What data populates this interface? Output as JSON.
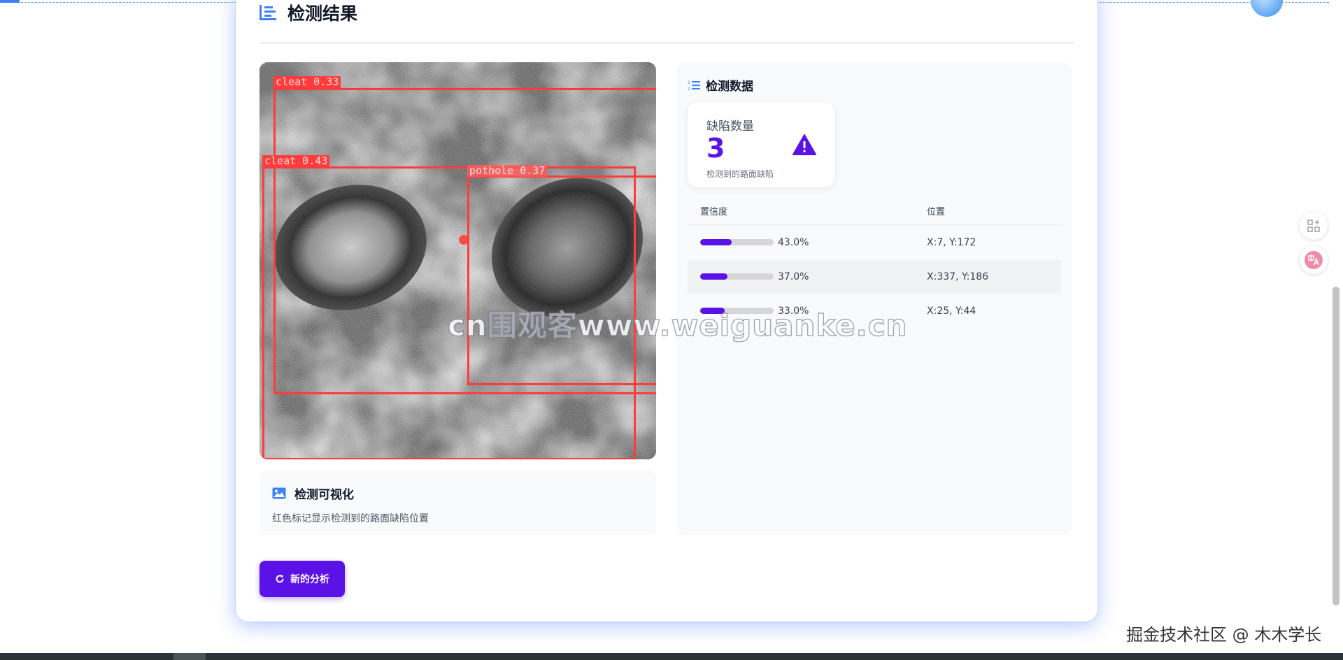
{
  "section": {
    "title": "检测结果"
  },
  "image": {
    "detections": [
      {
        "label": "cleat 0.33"
      },
      {
        "label": "cleat 0.43"
      },
      {
        "label": "pothole 0.37"
      }
    ]
  },
  "visualization": {
    "title": "检测可视化",
    "description": "红色标记显示检测到的路面缺陷位置"
  },
  "data_panel": {
    "title": "检测数据",
    "stat": {
      "label": "缺陷数量",
      "value": "3",
      "subtitle": "检测到的路面缺陷"
    },
    "table": {
      "headers": {
        "confidence": "置信度",
        "position": "位置"
      },
      "rows": [
        {
          "confidence": 0.43,
          "confidence_text": "43.0%",
          "position": "X:7, Y:172"
        },
        {
          "confidence": 0.37,
          "confidence_text": "37.0%",
          "position": "X:337, Y:186"
        },
        {
          "confidence": 0.33,
          "confidence_text": "33.0%",
          "position": "X:25, Y:44"
        }
      ]
    }
  },
  "actions": {
    "new_analysis": "新的分析"
  },
  "watermark": "cn围观客www.weiguanke.cn",
  "footer": "掘金技术社区 @ 木木学长",
  "colors": {
    "accent": "#5b12e6",
    "detection": "#ff3b3b",
    "icon_blue": "#3b82f6"
  }
}
